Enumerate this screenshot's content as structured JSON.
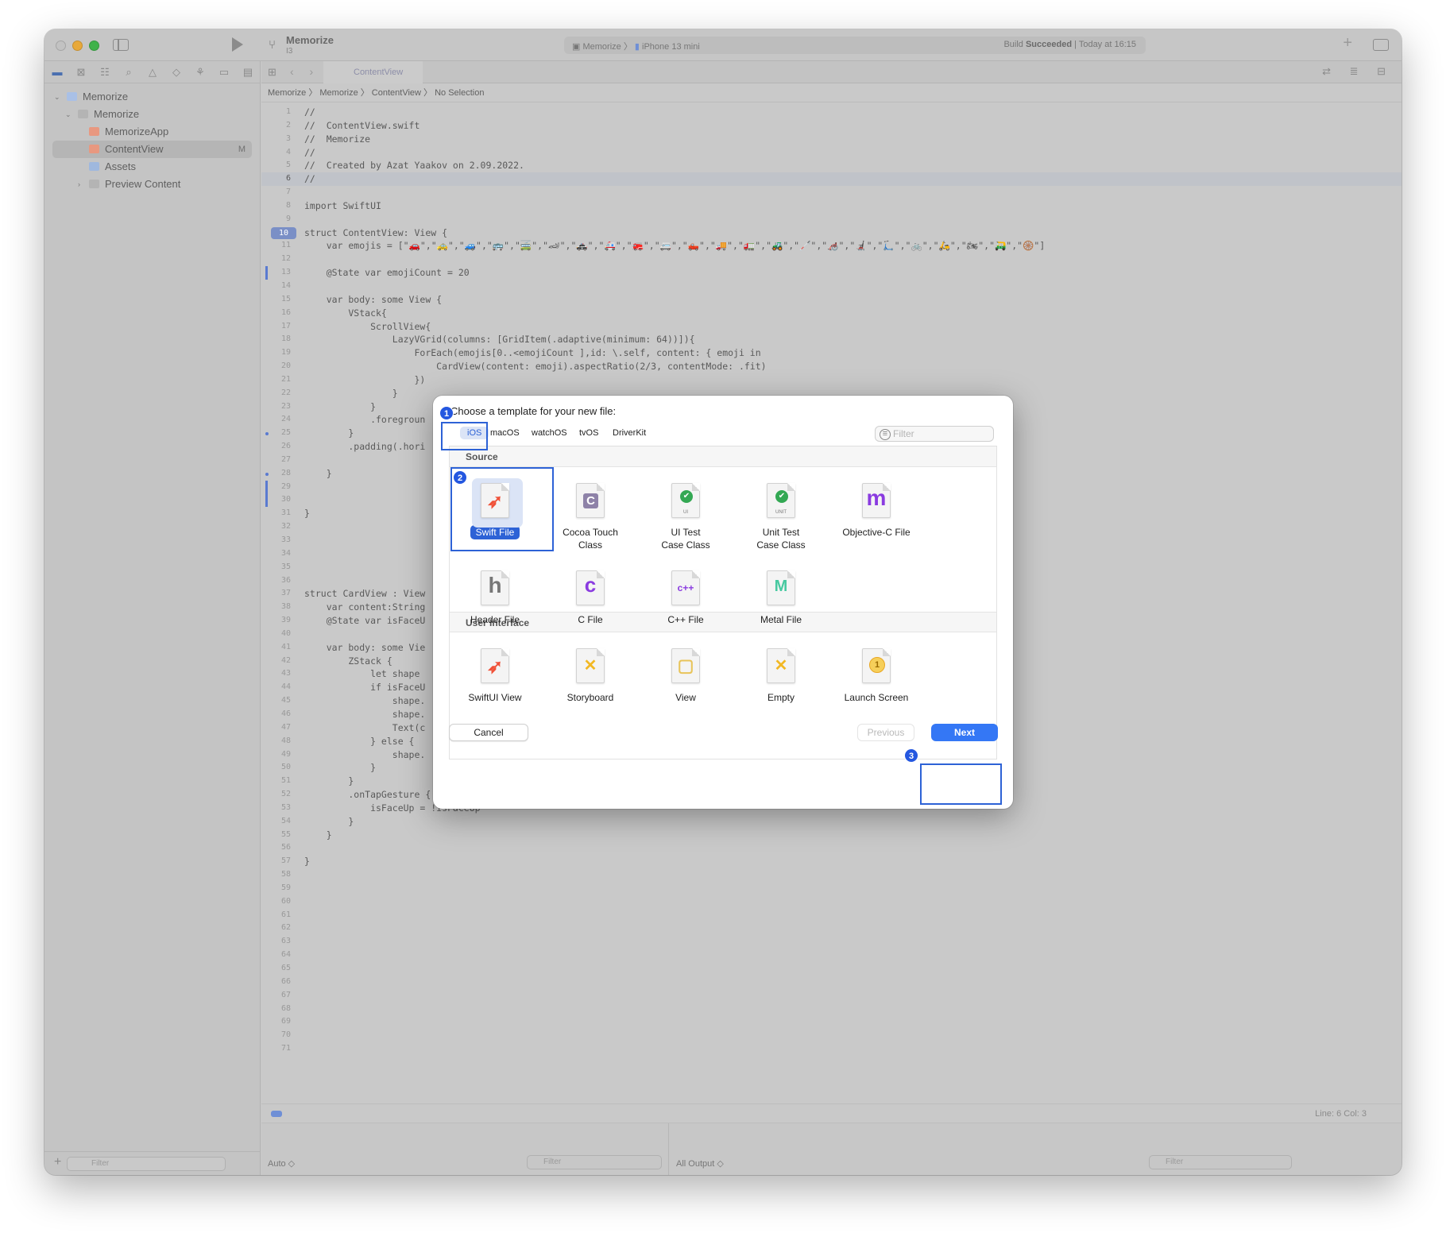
{
  "window": {
    "project_title": "Memorize",
    "project_subtitle": "I3",
    "scheme": "Memorize",
    "device": "iPhone 13 mini",
    "build_status_prefix": "Build ",
    "build_status_word": "Succeeded",
    "build_status_time": " | Today at 16:15"
  },
  "navigator": {
    "items": [
      {
        "label": "Memorize",
        "level": 0
      },
      {
        "label": "Memorize",
        "level": 1
      },
      {
        "label": "MemorizeApp",
        "level": 2
      },
      {
        "label": "ContentView",
        "level": 2,
        "badge": "M"
      },
      {
        "label": "Assets",
        "level": 2
      },
      {
        "label": "Preview Content",
        "level": 2
      }
    ],
    "filter_placeholder": "Filter"
  },
  "editor": {
    "tab_label": "ContentView",
    "breadcrumb": "Memorize 〉 Memorize 〉 ContentView 〉 No Selection",
    "status_position": "Line: 6  Col: 3",
    "lines": [
      "//",
      "//  ContentView.swift",
      "//  Memorize",
      "//",
      "//  Created by Azat Yaakov on 2.09.2022.",
      "//",
      "",
      "import SwiftUI",
      "",
      "struct ContentView: View {",
      "    var emojis = [\"🚗\",\"🚕\",\"🚙\",\"🚌\",\"🚎\",\"🏎\",\"🚓\",\"🚑\",\"🚒\",\"🚐\",\"🛻\",\"🚚\",\"🚛\",\"🚜\",\"🦯\",\"🦽\",\"🦼\",\"🛴\",\"🚲\",\"🛵\",\"🏍\",\"🛺\",\"🛞\"]",
      "",
      "    @State var emojiCount = 20",
      "",
      "    var body: some View {",
      "        VStack{",
      "            ScrollView{",
      "                LazyVGrid(columns: [GridItem(.adaptive(minimum: 64))]){",
      "                    ForEach(emojis[0..<emojiCount ],id: \\.self, content: { emoji in",
      "                        CardView(content: emoji).aspectRatio(2/3, contentMode: .fit)",
      "                    })",
      "                }",
      "            }",
      "            .foregroun",
      "        }",
      "        .padding(.hori",
      "",
      "    }",
      "",
      "",
      "}",
      "",
      "",
      "",
      "",
      "",
      "struct CardView : View",
      "    var content:String",
      "    @State var isFaceU",
      "",
      "    var body: some Vie",
      "        ZStack {",
      "            let shape",
      "            if isFaceU",
      "                shape.",
      "                shape.",
      "                Text(c",
      "            } else {",
      "                shape.",
      "            }",
      "        }",
      "        .onTapGesture {",
      "            isFaceUp = !isFaceUp",
      "        }",
      "    }",
      "",
      "}",
      "",
      "",
      "",
      "",
      "",
      "",
      "",
      "",
      "",
      "",
      "",
      "",
      "",
      ""
    ],
    "current_line": 6,
    "highlighted_line": 10
  },
  "debug": {
    "auto_label": "Auto ◇",
    "filter_placeholder": "Filter",
    "output_label": "All Output ◇",
    "filter2_placeholder": "Filter"
  },
  "dialog": {
    "title": "Choose a template for your new file:",
    "platforms": [
      "iOS",
      "macOS",
      "watchOS",
      "tvOS",
      "DriverKit"
    ],
    "filter_placeholder": "Filter",
    "sections": [
      {
        "title": "Source",
        "templates": [
          {
            "line1": "Swift File",
            "line2": "",
            "icon": "swift-icon"
          },
          {
            "line1": "Cocoa Touch",
            "line2": "Class",
            "icon": "cocoa-c-icon"
          },
          {
            "line1": "UI Test",
            "line2": "Case Class",
            "icon": "ui-test-check-icon"
          },
          {
            "line1": "Unit Test",
            "line2": "Case Class",
            "icon": "unit-test-check-icon"
          },
          {
            "line1": "Objective-C File",
            "line2": "",
            "icon": "objc-m-icon"
          },
          {
            "line1": "Header File",
            "line2": "",
            "icon": "header-h-icon"
          },
          {
            "line1": "C File",
            "line2": "",
            "icon": "c-file-icon"
          },
          {
            "line1": "C++ File",
            "line2": "",
            "icon": "cpp-file-icon"
          },
          {
            "line1": "Metal File",
            "line2": "",
            "icon": "metal-icon"
          }
        ]
      },
      {
        "title": "User Interface",
        "templates": [
          {
            "line1": "SwiftUI View",
            "line2": "",
            "icon": "swift-icon"
          },
          {
            "line1": "Storyboard",
            "line2": "",
            "icon": "storyboard-icon"
          },
          {
            "line1": "View",
            "line2": "",
            "icon": "view-icon"
          },
          {
            "line1": "Empty",
            "line2": "",
            "icon": "empty-icon"
          },
          {
            "line1": "Launch Screen",
            "line2": "",
            "icon": "launch-screen-icon"
          }
        ]
      }
    ],
    "doc_tags": {
      "ui": "UI",
      "unit": "UNIT",
      "launch": "1"
    },
    "cancel_label": "Cancel",
    "previous_label": "Previous",
    "next_label": "Next"
  },
  "annotations": [
    "1",
    "2",
    "3"
  ],
  "colors": {
    "accent": "#2d62d6",
    "next_button": "#3477f5",
    "swift": "#f05138",
    "check": "#33a853",
    "objc": "#8a3be0",
    "close": "#f15f56",
    "minimize": "#f5bd2f",
    "zoom": "#2bc740"
  }
}
